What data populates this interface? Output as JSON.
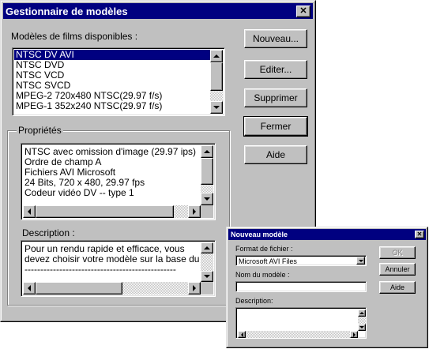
{
  "main_dialog": {
    "title": "Gestionnaire de modèles",
    "close_glyph": "✕",
    "models_label": "Modèles de films disponibles :",
    "models": [
      "NTSC DV AVI",
      "NTSC DVD",
      "NTSC VCD",
      "NTSC SVCD",
      "MPEG-2 720x480 NTSC(29.97 f/s)",
      "MPEG-1 352x240 NTSC(29.97 f/s)"
    ],
    "selected_index": 0,
    "buttons": {
      "new": "Nouveau...",
      "edit": "Editer...",
      "delete": "Supprimer",
      "close": "Fermer",
      "help": "Aide"
    },
    "properties_label": "Propriétés",
    "properties_lines": [
      "NTSC avec omission d'image (29.97 ips)",
      "Ordre de champ A",
      "Fichiers AVI Microsoft",
      "24 Bits, 720 x 480, 29.97 fps",
      "Codeur vidéo DV -- type 1"
    ],
    "description_label": "Description :",
    "description_lines": [
      "Pour un rendu rapide et efficace, vous",
      "devez choisir votre modèle sur la base du for",
      "------------------------------------------------"
    ]
  },
  "sub_dialog": {
    "title": "Nouveau modèle",
    "close_glyph": "✕",
    "format_label": "Format de fichier :",
    "format_value": "Microsoft AVI Files",
    "name_label": "Nom du modèle :",
    "name_value": "",
    "description_label": "Description:",
    "buttons": {
      "ok": "OK",
      "cancel": "Annuler",
      "help": "Aide"
    }
  },
  "colors": {
    "face": "#c0c0c0",
    "title": "#000080",
    "selection": "#000080"
  }
}
